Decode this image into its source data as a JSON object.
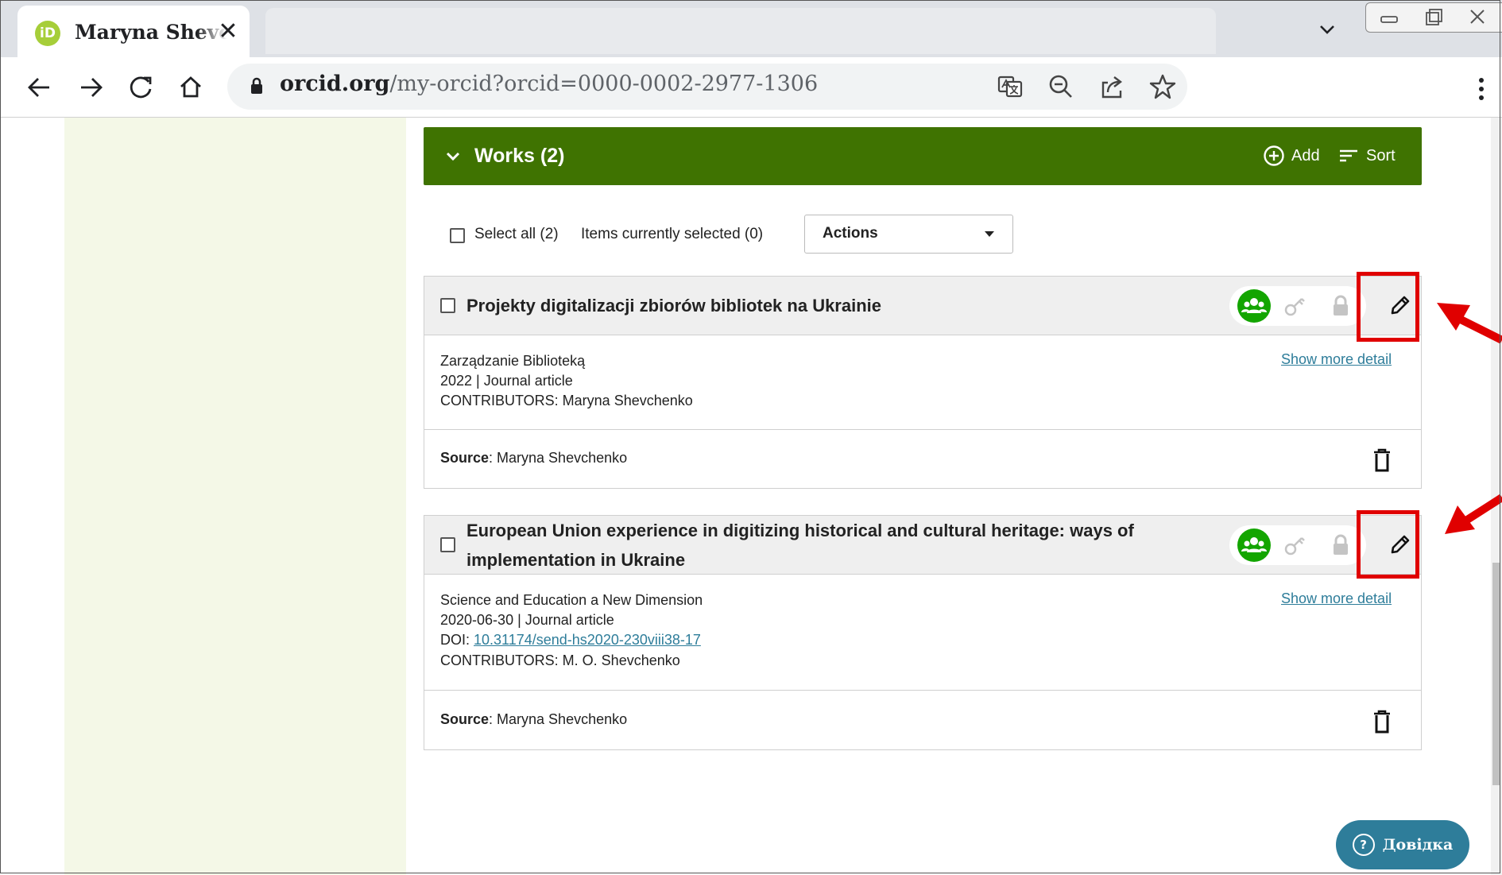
{
  "browser": {
    "tab_title": "Maryna Shevchenko",
    "tab_favicon": "iD",
    "tab_close": "✕",
    "url_host": "orcid.org",
    "url_path": "/my-orcid?orcid=0000-0002-2977-1306"
  },
  "works": {
    "header_title": "Works (2)",
    "add_label": "Add",
    "sort_label": "Sort",
    "select_all_label": "Select all (2)",
    "items_selected_label": "Items currently selected (0)",
    "actions_label": "Actions",
    "items": [
      {
        "title": "Projekty digitalizacji zbiorów bibliotek na Ukrainie",
        "journal": "Zarządzanie Biblioteką",
        "date_type": "2022 | Journal article",
        "contributors": "CONTRIBUTORS: Maryna Shevchenko",
        "show_more": "Show more detail",
        "source_label": "Source",
        "source_value": ": Maryna Shevchenko"
      },
      {
        "title_line1": "European Union experience in digitizing historical and cultural heritage: ways of",
        "title_line2": "implementation in Ukraine",
        "journal": "Science and Education a New Dimension",
        "date_type": "2020-06-30 | Journal article",
        "doi_label": "DOI: ",
        "doi_value": "10.31174/send-hs2020-230viii38-17",
        "contributors": "CONTRIBUTORS: M. O. Shevchenko",
        "show_more": "Show more detail",
        "source_label": "Source",
        "source_value": ": Maryna Shevchenko"
      }
    ]
  },
  "help_button": {
    "label": "Довідка",
    "icon_glyph": "?"
  },
  "colors": {
    "works_header": "#3f7301",
    "public_visibility": "#13a500",
    "link": "#2e7d9a",
    "highlight": "#e00000",
    "left_panel": "#f4f8e7"
  },
  "icons": [
    "orcid-favicon",
    "close-icon",
    "back-arrow-icon",
    "forward-arrow-icon",
    "reload-icon",
    "home-icon",
    "lock-icon",
    "translate-icon",
    "zoom-icon",
    "share-icon",
    "star-icon",
    "chevron-down-icon",
    "add-circle-icon",
    "sort-icon",
    "public-visibility-icon",
    "trusted-parties-key-icon",
    "private-lock-icon",
    "pencil-icon",
    "trash-icon",
    "help-icon"
  ]
}
